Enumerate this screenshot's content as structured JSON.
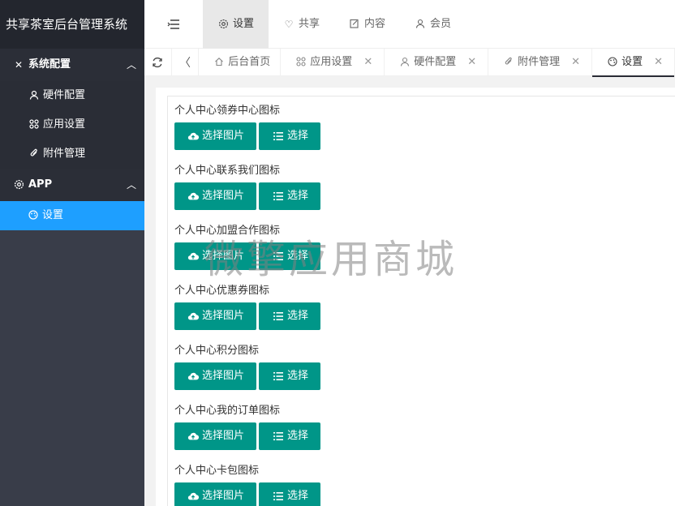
{
  "app": {
    "title": "共享茶室后台管理系统"
  },
  "sidebar": {
    "groups": [
      {
        "label": "系统配置",
        "icon": "wrench-icon",
        "expanded": true,
        "items": [
          {
            "label": "硬件配置",
            "icon": "user-icon"
          },
          {
            "label": "应用设置",
            "icon": "apps-icon"
          },
          {
            "label": "附件管理",
            "icon": "paperclip-icon"
          }
        ]
      },
      {
        "label": "APP",
        "icon": "gear-icon",
        "expanded": true,
        "items": [
          {
            "label": "设置",
            "icon": "palette-icon",
            "active": true
          }
        ]
      }
    ]
  },
  "header": {
    "tabs": [
      {
        "label": "设置",
        "icon": "gear-icon",
        "active": true
      },
      {
        "label": "共享",
        "icon": "heart-icon"
      },
      {
        "label": "内容",
        "icon": "edit-icon"
      },
      {
        "label": "会员",
        "icon": "user-icon"
      }
    ]
  },
  "tabbar": {
    "tabs": [
      {
        "label": "后台首页",
        "icon": "home-icon",
        "closable": false
      },
      {
        "label": "应用设置",
        "icon": "apps-icon",
        "closable": true
      },
      {
        "label": "硬件配置",
        "icon": "user-icon",
        "closable": true
      },
      {
        "label": "附件管理",
        "icon": "paperclip-icon",
        "closable": true
      },
      {
        "label": "设置",
        "icon": "palette-icon",
        "closable": true,
        "active": true
      }
    ]
  },
  "form": {
    "upload_label": "选择图片",
    "choose_label": "选择",
    "fields": [
      {
        "label": "个人中心领券中心图标"
      },
      {
        "label": "个人中心联系我们图标"
      },
      {
        "label": "个人中心加盟合作图标"
      },
      {
        "label": "个人中心优惠券图标"
      },
      {
        "label": "个人中心积分图标"
      },
      {
        "label": "个人中心我的订单图标"
      },
      {
        "label": "个人中心卡包图标"
      }
    ]
  },
  "watermark": "微擎应用商城",
  "colors": {
    "sidebar_bg": "#393d49",
    "active_nav": "#1e9fff",
    "button": "#009688"
  }
}
